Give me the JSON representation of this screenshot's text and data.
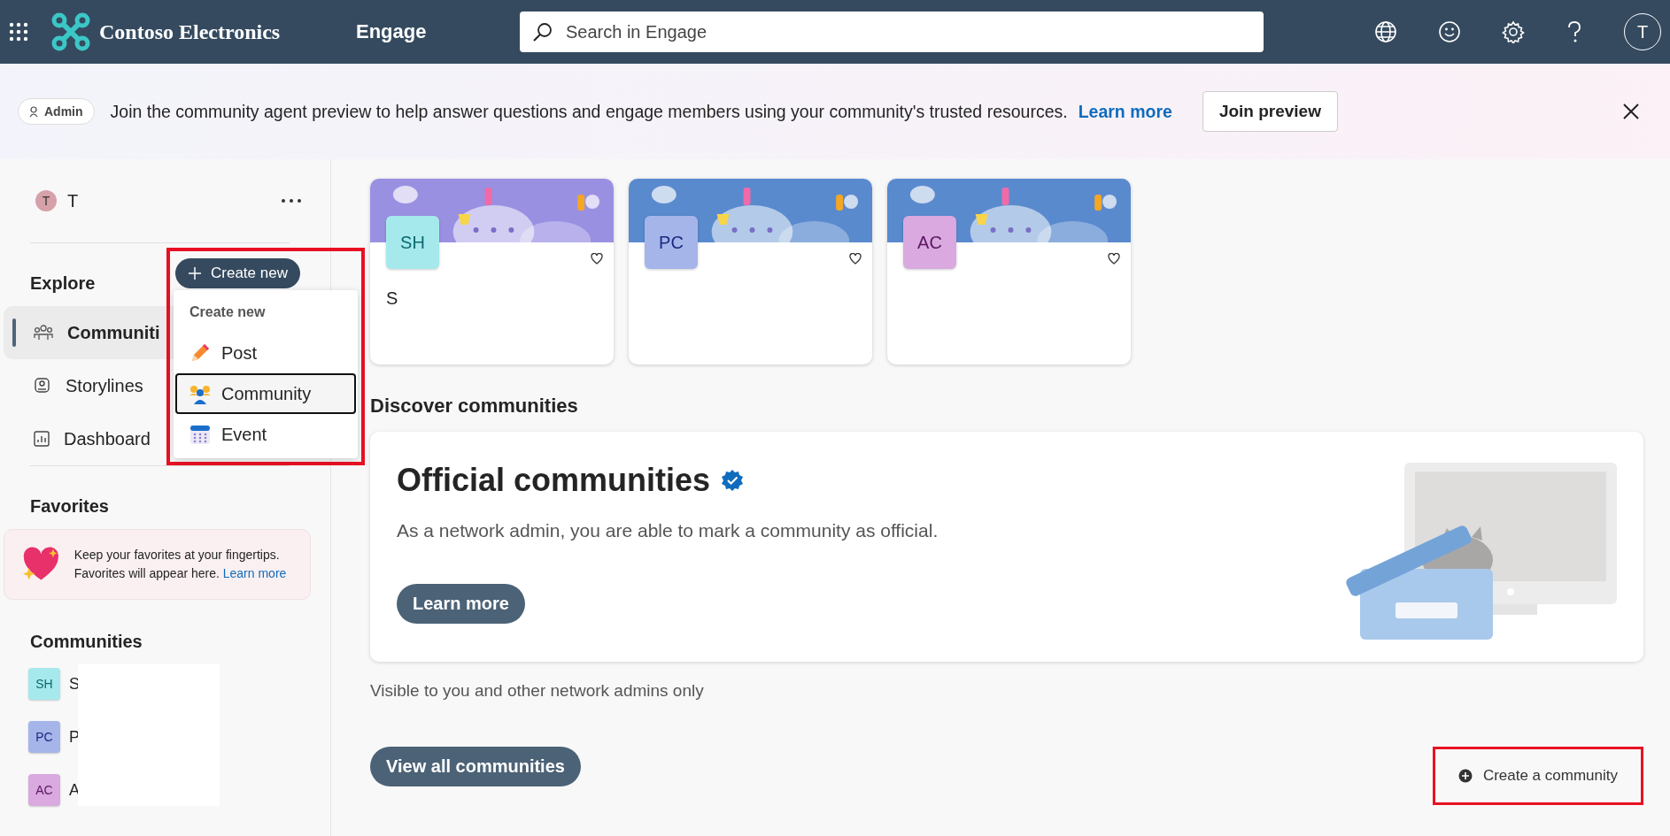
{
  "top_bar": {
    "brand": "Contoso Electronics",
    "app": "Engage",
    "search": {
      "placeholder": "Search in Engage"
    },
    "avatar": "T"
  },
  "banner": {
    "badge": "Admin",
    "message": "Join the community agent preview to help answer questions and engage members using your community's trusted resources.",
    "link": "Learn more",
    "button": "Join preview"
  },
  "sidebar": {
    "user": {
      "initial": "T",
      "name": "T"
    },
    "explore": {
      "title": "Explore",
      "items": [
        {
          "label": "Communiti",
          "kind": "communities",
          "selected": true
        },
        {
          "label": "Storylines",
          "kind": "storylines",
          "selected": false
        },
        {
          "label": "Dashboard",
          "kind": "dashboard",
          "selected": false
        }
      ]
    },
    "favorites": {
      "title": "Favorites",
      "text": "Keep your favorites at your fingertips. Favorites will appear here.",
      "link": "Learn more"
    },
    "communities": {
      "title": "Communities",
      "items": [
        {
          "initials": "SH",
          "name": "S",
          "color": "#a6e9ec"
        },
        {
          "initials": "PC",
          "name": "P",
          "color": "#a5b5ea"
        },
        {
          "initials": "AC",
          "name": "A",
          "color": "#d9a9df"
        }
      ]
    }
  },
  "create_menu": {
    "button": "Create new",
    "title": "Create new",
    "highlighted": true,
    "items": [
      {
        "label": "Post",
        "kind": "post",
        "selected": false
      },
      {
        "label": "Community",
        "kind": "community",
        "selected": true
      },
      {
        "label": "Event",
        "kind": "event",
        "selected": false
      }
    ]
  },
  "cards": [
    {
      "initials": "SH",
      "color": "#a6e9ec",
      "name": "S"
    },
    {
      "initials": "PC",
      "color": "#a5b5ea"
    },
    {
      "initials": "AC",
      "color": "#d9a9df"
    }
  ],
  "discover": {
    "title": "Discover communities",
    "official": {
      "title": "Official communities",
      "verified": true,
      "description": "As a network admin, you are able to mark a community as official.",
      "button": "Learn more"
    },
    "note": "Visible to you and other network admins only",
    "view_all": "View all communities",
    "create": {
      "label": "Create a community",
      "highlighted": true
    }
  }
}
